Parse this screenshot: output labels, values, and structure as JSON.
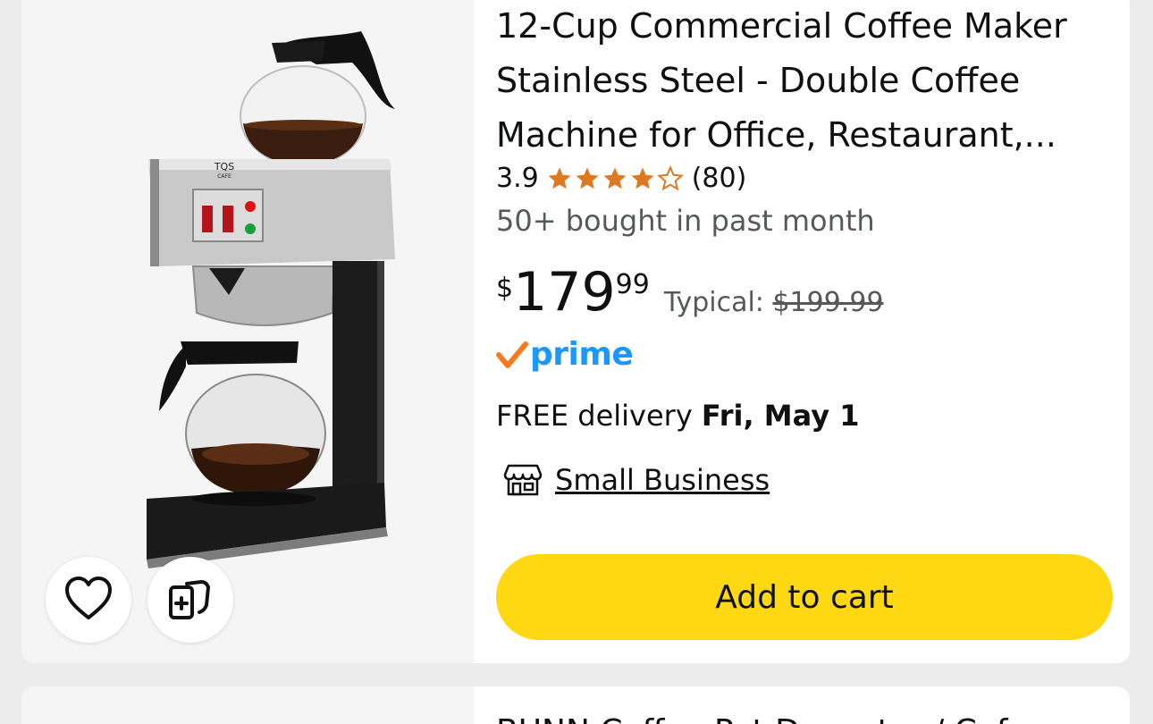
{
  "product": {
    "title": "12-Cup Commercial Coffee Maker Stainless Steel - Double Coffee Machine for Office, Restaurant,...",
    "rating": "3.9",
    "stars": 3.9,
    "review_count": "(80)",
    "bought": "50+ bought in past month",
    "price": {
      "symbol": "$",
      "whole": "179",
      "fraction": "99"
    },
    "typical_label": "Typical:",
    "typical_price": "$199.99",
    "prime_label": "prime",
    "delivery_prefix": "FREE delivery",
    "delivery_date": "Fri, May 1",
    "small_business": "Small Business",
    "add_to_cart": "Add to cart",
    "image_brand": "TQS",
    "image_brand_sub": "CAFE"
  },
  "next_product": {
    "title_peek": "BUNN Coffee Pot Decanter / Cof..."
  },
  "icons": {
    "favorite": "heart-icon",
    "compare": "compare-icon",
    "store": "store-icon",
    "prime_check": "check-icon"
  },
  "colors": {
    "cart_button": "#ffd814",
    "star": "#de7921",
    "prime_blue": "#1a98ff",
    "prime_check": "#f47b20",
    "muted_text": "#565959"
  }
}
